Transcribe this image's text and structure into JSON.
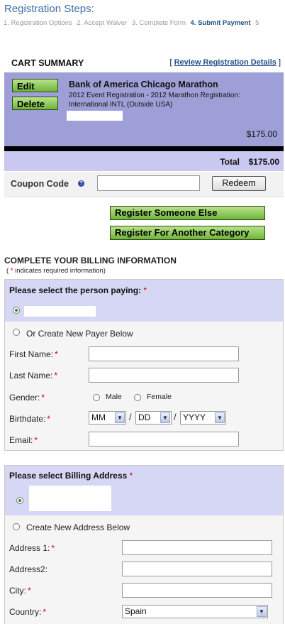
{
  "steps": {
    "title": "Registration Steps:",
    "items": [
      {
        "label": "1. Registration Options",
        "active": false
      },
      {
        "label": "2. Accept Waiver",
        "active": false
      },
      {
        "label": "3. Complete Form",
        "active": false
      },
      {
        "label": "4. Submit Payment",
        "active": true
      },
      {
        "label": "5",
        "active": false
      }
    ]
  },
  "cart": {
    "title": "CART SUMMARY",
    "review_open": "[",
    "review_link": "Review Registration Details",
    "review_close": "]",
    "edit_label": "Edit",
    "delete_label": "Delete",
    "item_name": "Bank of America Chicago Marathon",
    "item_desc": "2012 Event Registration - 2012 Marathon Registration: International INTL (Outside USA)",
    "item_price": "$175.00",
    "total_label": "Total",
    "total_value": "$175.00",
    "coupon_label": "Coupon Code",
    "coupon_value": "",
    "redeem_label": "Redeem",
    "register_someone_else": "Register Someone Else",
    "register_another_category": "Register For Another Category"
  },
  "billing": {
    "title": "COMPLETE YOUR BILLING INFORMATION",
    "req_open": "( ",
    "req_star": "*",
    "req_text": " indicates required information)",
    "payer": {
      "title": "Please select the person paying:",
      "star": "*",
      "new_payer_label": "Or Create New Payer Below",
      "first_name_label": "First Name:",
      "last_name_label": "Last Name:",
      "gender_label": "Gender:",
      "male_label": "Male",
      "female_label": "Female",
      "birthdate_label": "Birthdate:",
      "month_value": "MM",
      "day_value": "DD",
      "year_value": "YYYY",
      "date_sep": "/",
      "email_label": "Email:"
    },
    "address": {
      "title": "Please select Billing Address",
      "star": "*",
      "new_address_label": "Create New Address Below",
      "address1_label": "Address 1:",
      "address2_label": "Address2:",
      "city_label": "City:",
      "country_label": "Country:",
      "country_value": "Spain"
    }
  }
}
